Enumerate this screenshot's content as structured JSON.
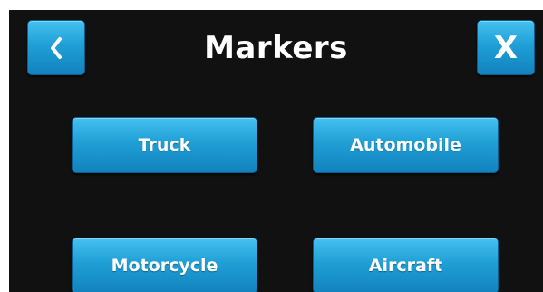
{
  "header": {
    "title": "Markers",
    "back_icon": "chevron-left-icon",
    "close_label": "X"
  },
  "markers": {
    "truck": "Truck",
    "automobile": "Automobile",
    "motorcycle": "Motorcycle",
    "aircraft": "Aircraft"
  },
  "colors": {
    "background": "#111111",
    "button_blue": "#1f9fd6",
    "button_text": "#ffffff"
  }
}
